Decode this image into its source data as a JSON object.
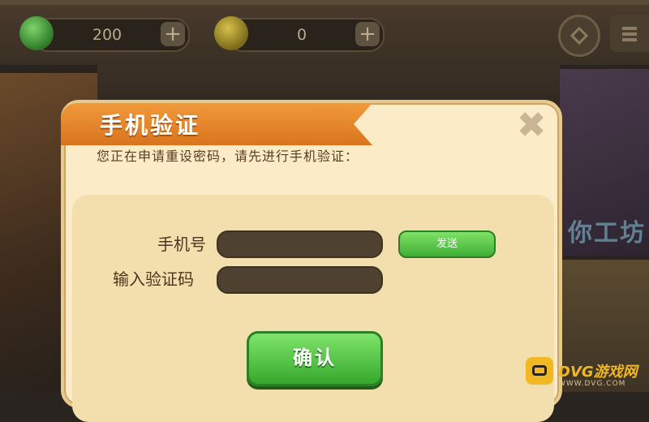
{
  "topbar": {
    "gem_count": "200",
    "coin_count": "0",
    "plus_symbol": "+"
  },
  "background": {
    "sign_text": "你工坊"
  },
  "dialog": {
    "title": "手机验证",
    "close_symbol": "✖",
    "intro": "您正在申请重设密码，请先进行手机验证：",
    "phone_label": "手机号",
    "code_label": "输入验证码",
    "phone_value": "",
    "code_value": "",
    "send_label": "发送",
    "confirm_label": "确认"
  },
  "watermark": {
    "name": "DVG游戏网",
    "url": "WWW.DVG.COM"
  },
  "colors": {
    "ribbon": "#e8852a",
    "dialog_bg": "#fbebc6",
    "button_green": "#4cbc3e",
    "field_dark": "#4e4130"
  },
  "icons": {
    "gem": "green-gem-icon",
    "coin": "gold-coin-icon",
    "close": "close-x-icon"
  }
}
